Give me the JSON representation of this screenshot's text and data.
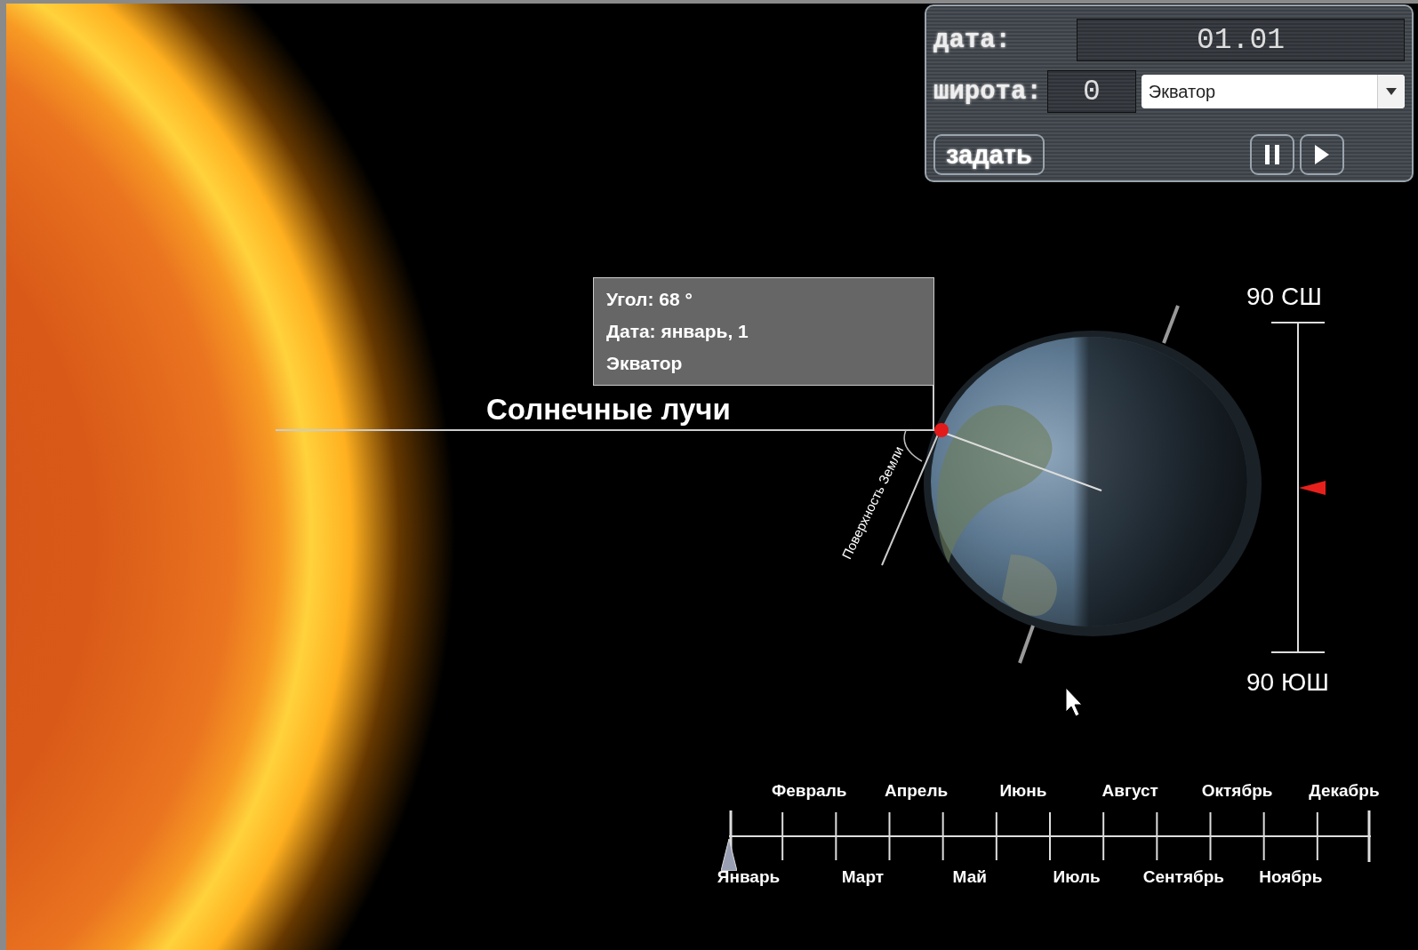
{
  "controls": {
    "date_label": "дата:",
    "date_value": "01.01",
    "latitude_label": "широта:",
    "latitude_value": "0",
    "zone_select": "Экватор",
    "set_button": "задать"
  },
  "info_box": {
    "lines": [
      "Угол: 68 °",
      "Дата: январь, 1",
      "Экватор"
    ]
  },
  "rays_label": "Солнечные лучи",
  "surface_label": "Поверхность Земли",
  "latitude_scale": {
    "top_label": "90 СШ",
    "bottom_label": "90 ЮШ",
    "level": 0.5
  },
  "timeline": {
    "level": 0,
    "months": [
      "Январь",
      "Февраль",
      "Март",
      "Апрель",
      "Май",
      "Июнь",
      "Июль",
      "Август",
      "Сентябрь",
      "Октябрь",
      "Ноябрь",
      "Декабрь"
    ]
  }
}
